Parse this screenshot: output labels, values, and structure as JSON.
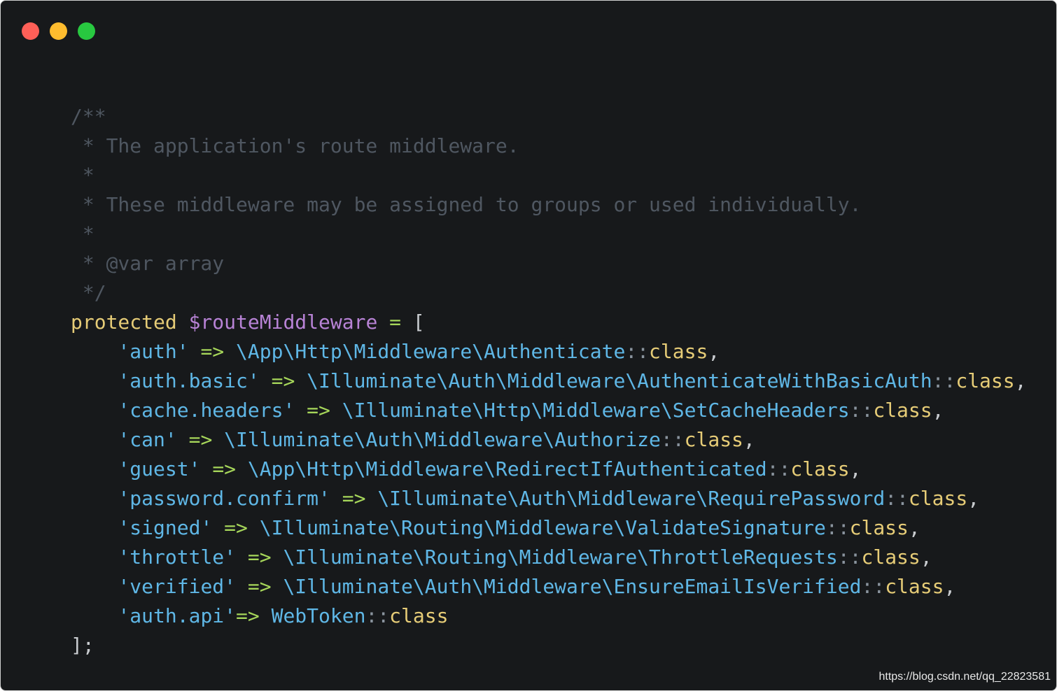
{
  "window": {
    "controls": [
      "close",
      "minimize",
      "zoom"
    ],
    "colors": {
      "close": "#fe5f57",
      "minimize": "#febc2e",
      "zoom": "#28c840",
      "background": "#17191b"
    }
  },
  "code": {
    "comment": [
      "/**",
      " * The application's route middleware.",
      " *",
      " * These middleware may be assigned to groups or used individually.",
      " *",
      " * @var array",
      " */"
    ],
    "declaration": {
      "keyword": "protected",
      "variable": "$routeMiddleware",
      "assign": "=",
      "open": "["
    },
    "entries": [
      {
        "key": "'auth'",
        "arrow": "=>",
        "class_path": "\\App\\Http\\Middleware\\Authenticate",
        "suffix": ","
      },
      {
        "key": "'auth.basic'",
        "arrow": "=>",
        "class_path": "\\Illuminate\\Auth\\Middleware\\AuthenticateWithBasicAuth",
        "suffix": ","
      },
      {
        "key": "'cache.headers'",
        "arrow": "=>",
        "class_path": "\\Illuminate\\Http\\Middleware\\SetCacheHeaders",
        "suffix": ","
      },
      {
        "key": "'can'",
        "arrow": "=>",
        "class_path": "\\Illuminate\\Auth\\Middleware\\Authorize",
        "suffix": ","
      },
      {
        "key": "'guest'",
        "arrow": "=>",
        "class_path": "\\App\\Http\\Middleware\\RedirectIfAuthenticated",
        "suffix": ","
      },
      {
        "key": "'password.confirm'",
        "arrow": "=>",
        "class_path": "\\Illuminate\\Auth\\Middleware\\RequirePassword",
        "suffix": ","
      },
      {
        "key": "'signed'",
        "arrow": "=>",
        "class_path": "\\Illuminate\\Routing\\Middleware\\ValidateSignature",
        "suffix": ","
      },
      {
        "key": "'throttle'",
        "arrow": "=>",
        "class_path": "\\Illuminate\\Routing\\Middleware\\ThrottleRequests",
        "suffix": ","
      },
      {
        "key": "'verified'",
        "arrow": "=>",
        "class_path": "\\Illuminate\\Auth\\Middleware\\EnsureEmailIsVerified",
        "suffix": ","
      },
      {
        "key": "'auth.api'",
        "arrow": "=>",
        "class_path": "WebToken",
        "suffix": "",
        "tight_arrow": true
      }
    ],
    "double_colon": "::",
    "class_keyword": "class",
    "close": "];"
  },
  "watermark": "https://blog.csdn.net/qq_22823581"
}
